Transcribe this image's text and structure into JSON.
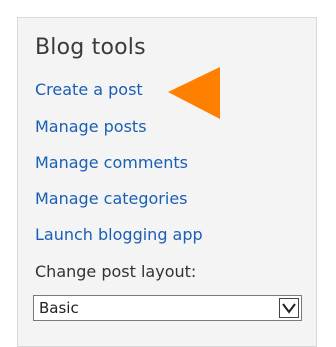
{
  "panel": {
    "title": "Blog tools",
    "links": [
      "Create a post",
      "Manage posts",
      "Manage comments",
      "Manage categories",
      "Launch blogging app"
    ],
    "layout_label": "Change post layout:",
    "layout_select": {
      "value": "Basic"
    }
  },
  "colors": {
    "link": "#1a5fb4",
    "pointer": "#ff8000",
    "panel_bg": "#f4f4f4"
  },
  "icons": {
    "pointer": "orange-pointer-arrow",
    "dropdown": "chevron-down-icon"
  }
}
